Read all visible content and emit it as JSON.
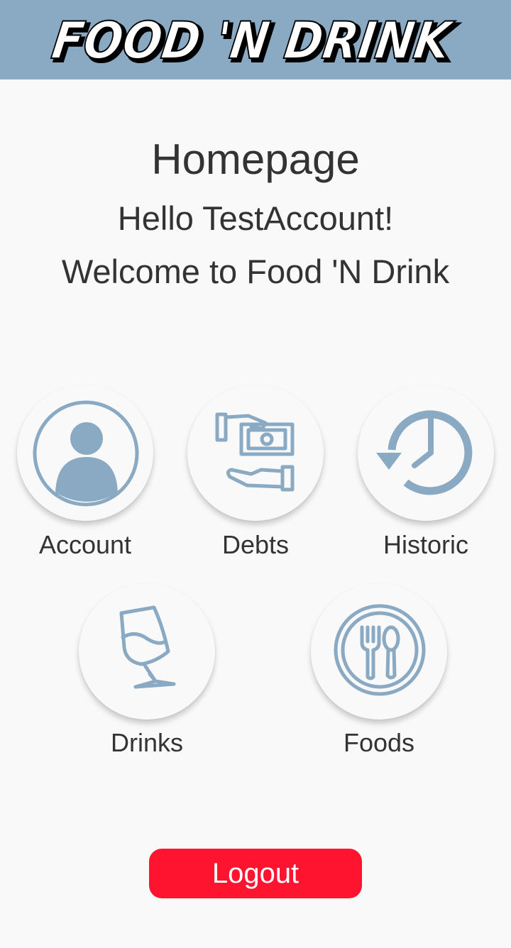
{
  "header": {
    "logo_text": "FOOD 'N DRINK",
    "color": "#8aa9c3"
  },
  "page": {
    "title": "Homepage",
    "greeting": "Hello TestAccount!",
    "welcome": "Welcome to Food 'N Drink"
  },
  "menu": {
    "account": {
      "label": "Account",
      "icon": "user-icon"
    },
    "debts": {
      "label": "Debts",
      "icon": "money-hand-icon"
    },
    "historic": {
      "label": "Historic",
      "icon": "history-clock-icon"
    },
    "drinks": {
      "label": "Drinks",
      "icon": "wine-glass-icon"
    },
    "foods": {
      "label": "Foods",
      "icon": "plate-cutlery-icon"
    }
  },
  "actions": {
    "logout_label": "Logout"
  },
  "colors": {
    "icon": "#8aa9c3",
    "logout": "#ff1430",
    "background": "#f9f9f9"
  }
}
